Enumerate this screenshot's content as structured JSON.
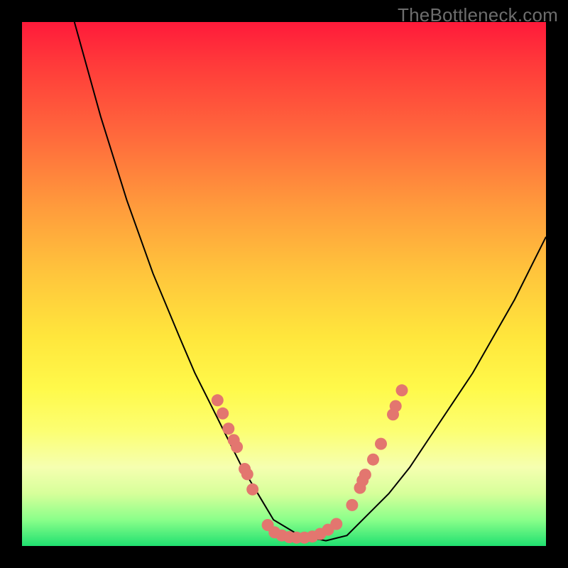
{
  "watermark": "TheBottleneck.com",
  "colors": {
    "dot_fill": "#e3766f",
    "curve_stroke": "#000000"
  },
  "chart_data": {
    "type": "line",
    "title": "",
    "xlabel": "",
    "ylabel": "",
    "xlim": [
      0,
      100
    ],
    "ylim": [
      0,
      100
    ],
    "grid": false,
    "legend": false,
    "note": "No numeric axes or tick labels are visible; all values are pixel-normalized (0–100) estimates of the plotted curve and markers.",
    "series": [
      {
        "name": "curve",
        "style": "line",
        "x": [
          10,
          15,
          20,
          25,
          30,
          33,
          36,
          39,
          42,
          45,
          48,
          53,
          58,
          62,
          66,
          70,
          74,
          78,
          82,
          86,
          90,
          94,
          98,
          100
        ],
        "y": [
          100,
          82,
          66,
          52,
          40,
          33,
          27,
          21,
          15,
          10,
          5,
          2,
          1,
          2,
          6,
          10,
          15,
          21,
          27,
          33,
          40,
          47,
          55,
          59
        ]
      },
      {
        "name": "left-dots",
        "style": "scatter",
        "x": [
          37.3,
          38.3,
          39.4,
          40.4,
          41.0,
          42.5,
          43.0,
          44.0
        ],
        "y": [
          27.8,
          25.3,
          22.4,
          20.2,
          18.9,
          14.7,
          13.7,
          10.8
        ]
      },
      {
        "name": "right-dots",
        "style": "scatter",
        "x": [
          63.0,
          64.5,
          65.5,
          65.0,
          67.0,
          68.5,
          70.8,
          71.3,
          72.5
        ],
        "y": [
          7.8,
          11.1,
          13.6,
          12.5,
          16.5,
          19.5,
          25.1,
          26.7,
          29.7
        ]
      },
      {
        "name": "bottom-dots",
        "style": "scatter",
        "x": [
          46.9,
          48.2,
          49.6,
          51.0,
          52.4,
          53.9,
          55.4,
          56.9,
          58.4,
          60.0
        ],
        "y": [
          4.0,
          2.6,
          2.0,
          1.7,
          1.6,
          1.6,
          1.8,
          2.3,
          3.1,
          4.2
        ]
      }
    ]
  }
}
